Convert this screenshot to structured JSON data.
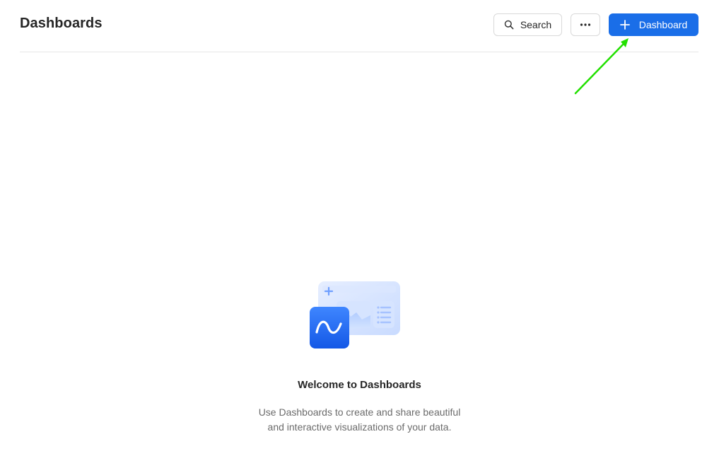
{
  "header": {
    "title": "Dashboards",
    "search_label": "Search",
    "add_label": "Dashboard"
  },
  "icons": {
    "search": "search-icon",
    "more": "ellipsis-icon",
    "add": "plus-icon"
  },
  "colors": {
    "primary": "#1a6ee8",
    "annotation_arrow": "#22e000"
  },
  "empty_state": {
    "title": "Welcome to Dashboards",
    "description_line1": "Use Dashboards to create and share beautiful",
    "description_line2": "and interactive visualizations of your data."
  }
}
